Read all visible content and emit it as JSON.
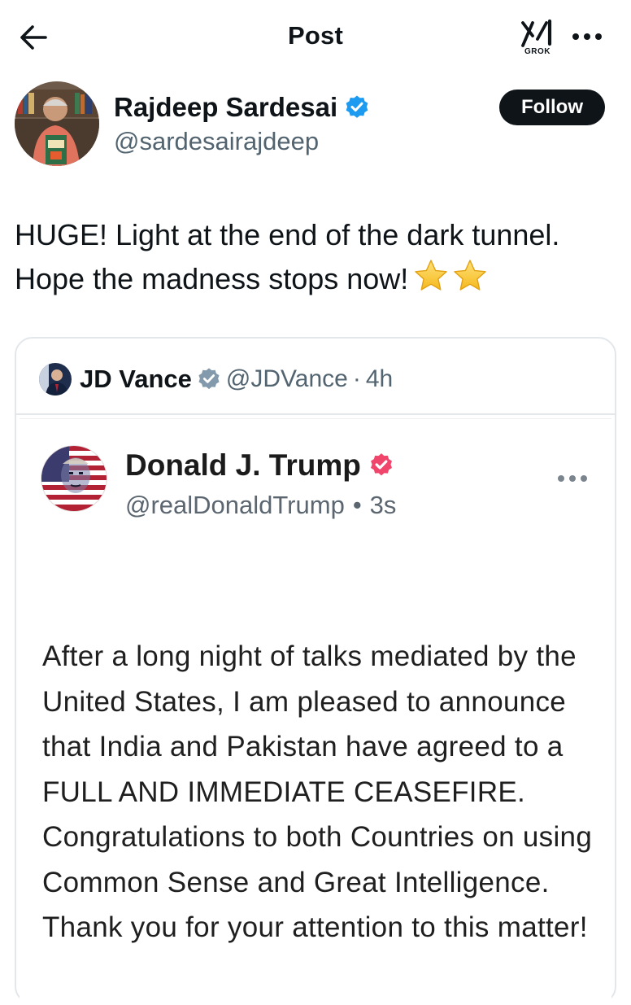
{
  "header": {
    "title": "Post",
    "grok_label": "GROK"
  },
  "author": {
    "name": "Rajdeep Sardesai",
    "handle": "@sardesairajdeep",
    "follow_label": "Follow"
  },
  "post": {
    "text": "HUGE! Light at the end of the dark tunnel. Hope the madness stops now!",
    "emoji": "⭐⭐"
  },
  "quote": {
    "name": "JD Vance",
    "handle": "@JDVance",
    "separator": "·",
    "time": "4h",
    "embed": {
      "name": "Donald J. Trump",
      "handle": "@realDonaldTrump",
      "separator": "•",
      "time": "3s",
      "text": "After a long night of talks mediated by the United States, I am pleased to announce that India and Pakistan have agreed to a FULL AND IMMEDIATE CEASEFIRE. Congratulations to both Countries on using Common Sense and Great Intelligence. Thank you for your attention to this matter!"
    }
  },
  "colors": {
    "text": "#0f1419",
    "secondary": "#536471",
    "verified_blue": "#1d9bf0",
    "verified_gray": "#829aab",
    "truth_badge": "#f0466c",
    "border": "#e3e7ea"
  }
}
